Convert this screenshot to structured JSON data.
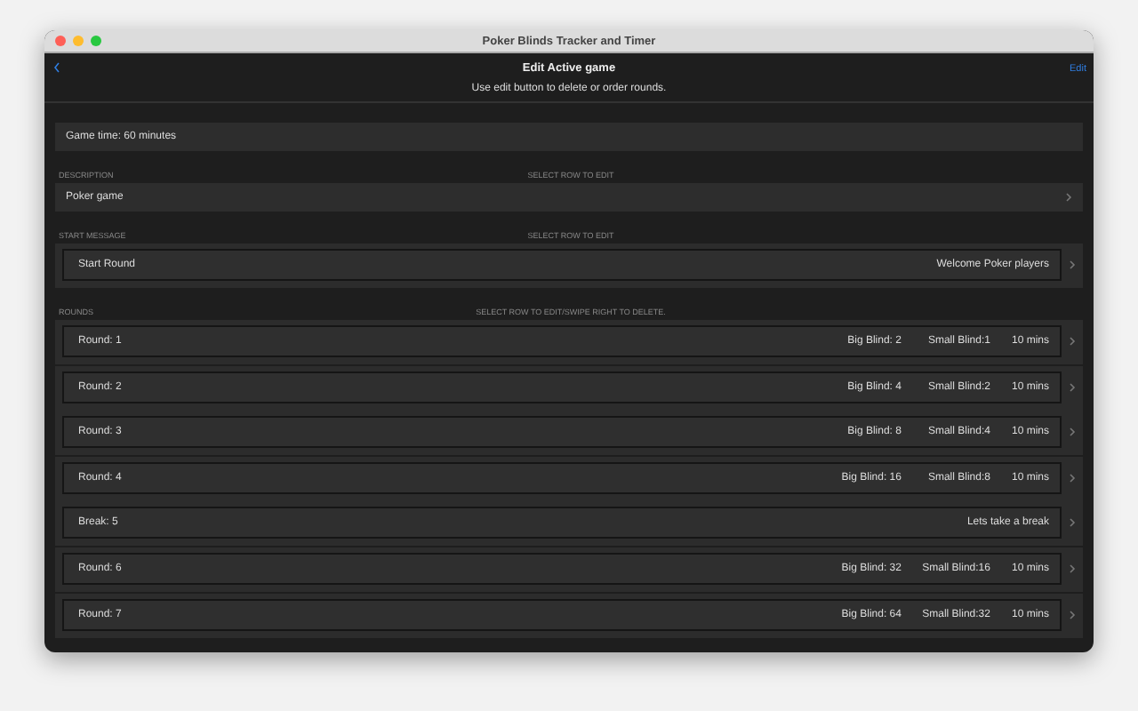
{
  "window": {
    "title": "Poker Blinds Tracker and Timer"
  },
  "nav": {
    "title": "Edit Active game",
    "subtitle": "Use edit button to delete or order rounds.",
    "edit": "Edit"
  },
  "game_time": "Game time: 60 minutes",
  "description": {
    "label": "DESCRIPTION",
    "hint": "SELECT ROW TO EDIT",
    "value": "Poker game"
  },
  "start_message": {
    "label": "START MESSAGE",
    "hint": "SELECT ROW TO EDIT",
    "name": "Start Round",
    "message": "Welcome Poker players"
  },
  "rounds": {
    "label": "ROUNDS",
    "hint": "SELECT ROW TO EDIT/SWIPE RIGHT TO DELETE.",
    "items": [
      {
        "kind": "round",
        "label": "Round: 1",
        "big_blind": "Big Blind: 2",
        "small_blind": "Small Blind:1",
        "duration": "10 mins"
      },
      {
        "kind": "round",
        "label": "Round: 2",
        "big_blind": "Big Blind: 4",
        "small_blind": "Small Blind:2",
        "duration": "10 mins"
      },
      {
        "kind": "round",
        "label": "Round: 3",
        "big_blind": "Big Blind: 8",
        "small_blind": "Small Blind:4",
        "duration": "10 mins"
      },
      {
        "kind": "round",
        "label": "Round: 4",
        "big_blind": "Big Blind: 16",
        "small_blind": "Small Blind:8",
        "duration": "10 mins"
      },
      {
        "kind": "break",
        "label": "Break: 5",
        "message": "Lets take a break"
      },
      {
        "kind": "round",
        "label": "Round: 6",
        "big_blind": "Big Blind: 32",
        "small_blind": "Small Blind:16",
        "duration": "10 mins"
      },
      {
        "kind": "round",
        "label": "Round: 7",
        "big_blind": "Big Blind: 64",
        "small_blind": "Small Blind:32",
        "duration": "10 mins"
      }
    ]
  }
}
